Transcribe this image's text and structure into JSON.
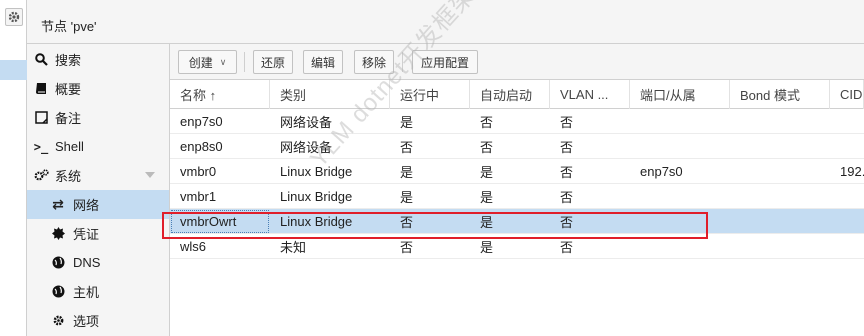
{
  "header": {
    "node_title": "节点 'pve'"
  },
  "nav": {
    "items": [
      {
        "label": "搜索",
        "icon": "search-icon"
      },
      {
        "label": "概要",
        "icon": "book-icon"
      },
      {
        "label": "备注",
        "icon": "note-icon"
      },
      {
        "label": "Shell",
        "icon": "terminal-icon"
      },
      {
        "label": "系统",
        "icon": "gears-icon"
      },
      {
        "label": "网络",
        "icon": "exchange-icon"
      },
      {
        "label": "凭证",
        "icon": "certificate-icon"
      },
      {
        "label": "DNS",
        "icon": "globe-icon"
      },
      {
        "label": "主机",
        "icon": "globe-icon"
      },
      {
        "label": "选项",
        "icon": "gear-icon"
      }
    ]
  },
  "toolbar": {
    "create": "创建",
    "revert": "还原",
    "edit": "编辑",
    "remove": "移除",
    "apply": "应用配置"
  },
  "grid": {
    "columns": [
      "名称 ↑",
      "类别",
      "运行中",
      "自动启动",
      "VLAN ...",
      "端口/从属",
      "Bond 模式",
      "CIDR"
    ],
    "rows": [
      [
        "enp7s0",
        "网络设备",
        "是",
        "否",
        "否",
        "",
        "",
        ""
      ],
      [
        "enp8s0",
        "网络设备",
        "否",
        "否",
        "否",
        "",
        "",
        ""
      ],
      [
        "vmbr0",
        "Linux Bridge",
        "是",
        "是",
        "否",
        "enp7s0",
        "",
        "192."
      ],
      [
        "vmbr1",
        "Linux Bridge",
        "是",
        "是",
        "否",
        "",
        "",
        ""
      ],
      [
        "vmbrOwrt",
        "Linux Bridge",
        "否",
        "是",
        "否",
        "",
        "",
        ""
      ],
      [
        "wls6",
        "未知",
        "否",
        "是",
        "否",
        "",
        "",
        ""
      ]
    ]
  },
  "watermark": "YLM dotnet开发框架 www.ylsdotnet.com",
  "colors": {
    "selection": "#c4dcf2",
    "highlight_box": "#e01e2a"
  }
}
